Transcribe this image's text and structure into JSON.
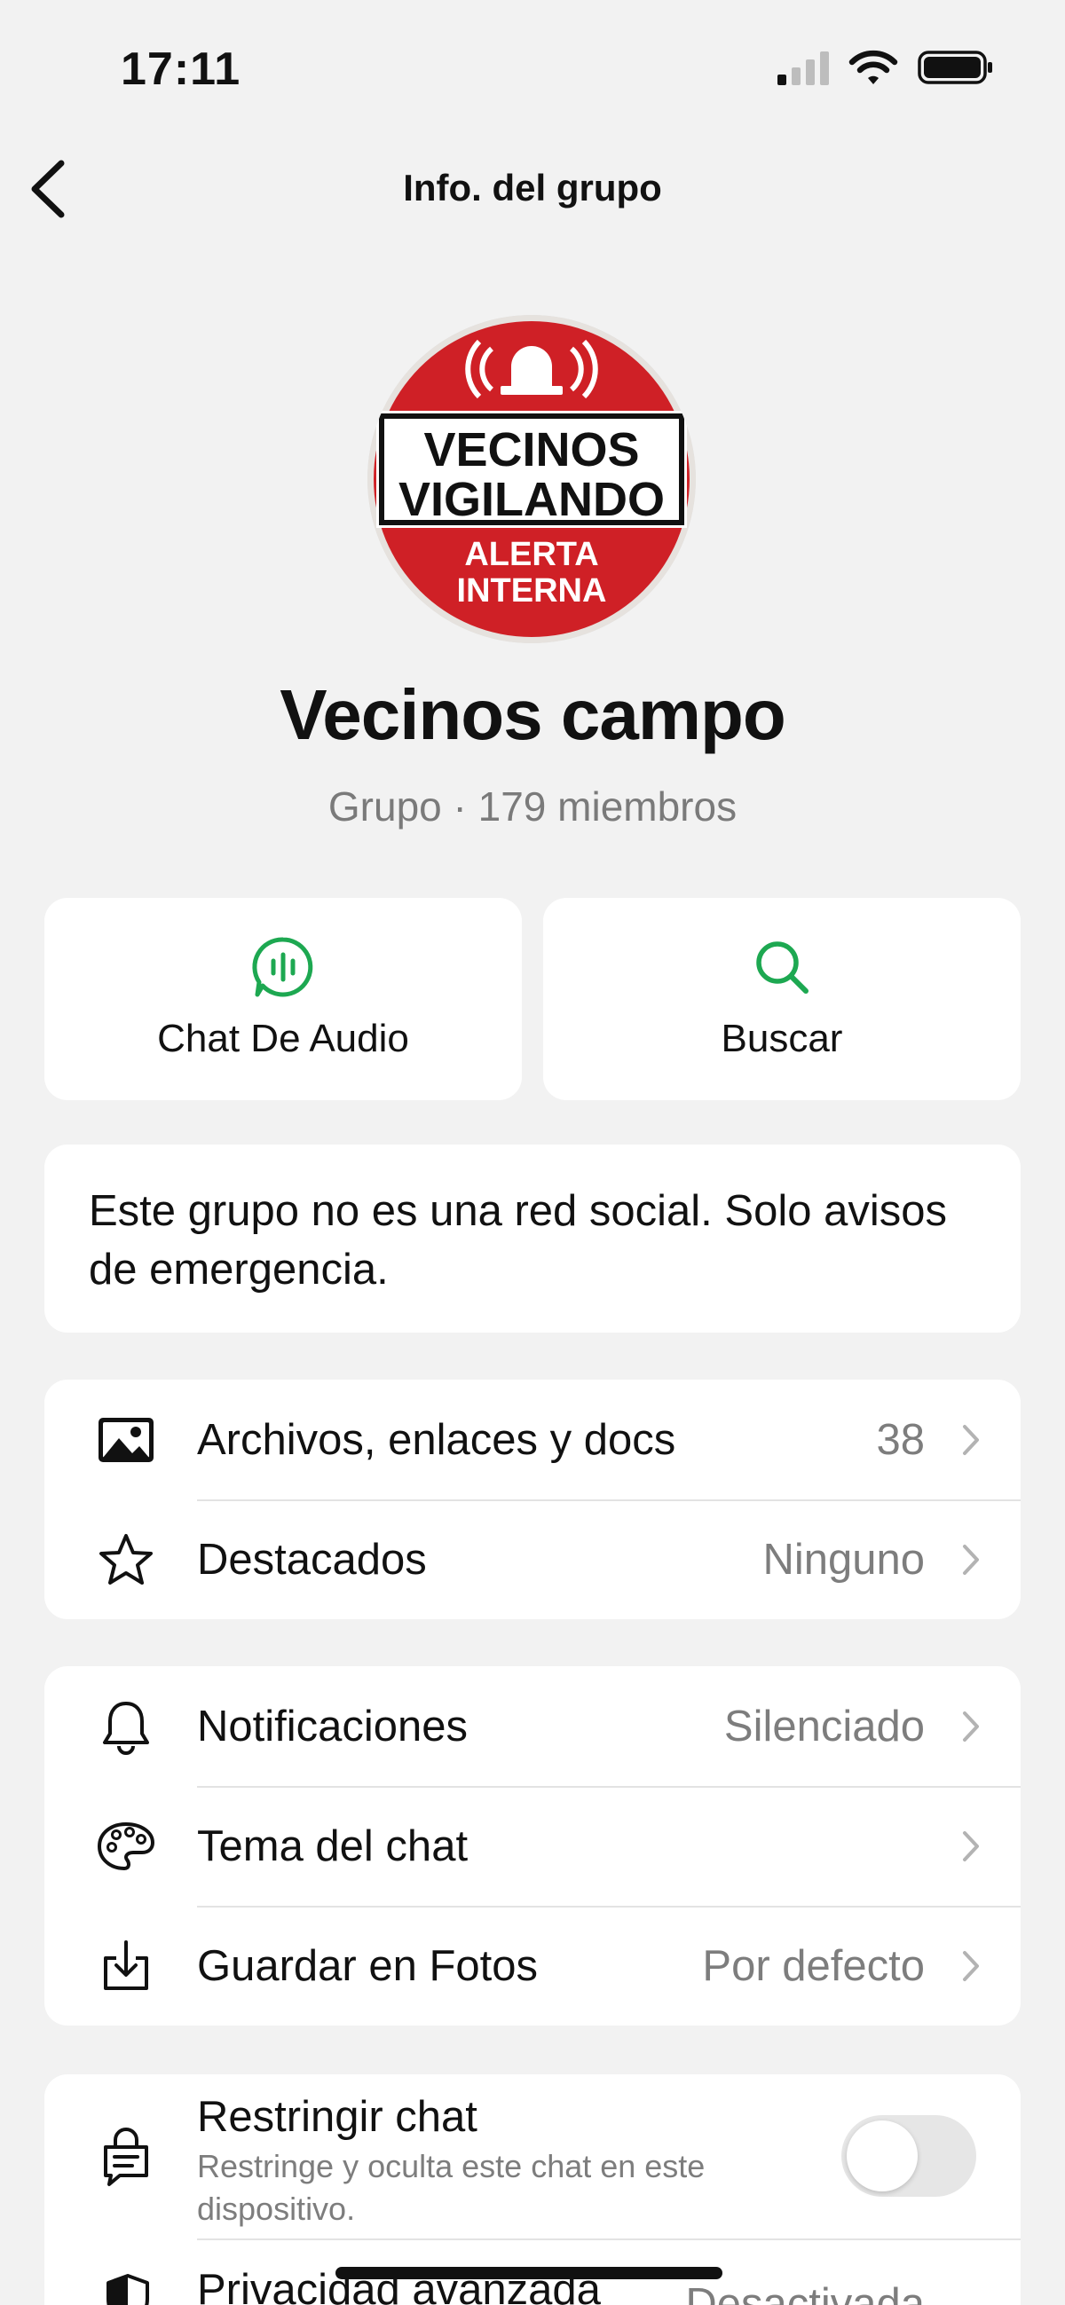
{
  "status_bar": {
    "time": "17:11"
  },
  "nav": {
    "title": "Info. del grupo"
  },
  "group": {
    "avatar": {
      "line1": "VECINOS",
      "line2": "VIGILANDO",
      "line3": "ALERTA",
      "line4": "INTERNA"
    },
    "name": "Vecinos campo",
    "subtitle": "Grupo · 179 miembros"
  },
  "actions": [
    {
      "label": "Chat De Audio",
      "icon": "audio-chat-icon"
    },
    {
      "label": "Buscar",
      "icon": "search-icon"
    }
  ],
  "description": "Este grupo no es una red social. Solo avisos de emergencia.",
  "media_section": [
    {
      "label": "Archivos, enlaces y docs",
      "value": "38",
      "icon": "image-icon"
    },
    {
      "label": "Destacados",
      "value": "Ninguno",
      "icon": "star-icon"
    }
  ],
  "settings_section": [
    {
      "label": "Notificaciones",
      "value": "Silenciado",
      "icon": "bell-icon"
    },
    {
      "label": "Tema del chat",
      "value": "",
      "icon": "palette-icon"
    },
    {
      "label": "Guardar en Fotos",
      "value": "Por defecto",
      "icon": "save-download-icon"
    }
  ],
  "privacy_section": {
    "restrict": {
      "label": "Restringir chat",
      "description": "Restringe y oculta este chat en este dispositivo.",
      "enabled": false
    },
    "advanced": {
      "label": "Privacidad avanzada",
      "value": "Desactivada"
    }
  },
  "colors": {
    "accent": "#1DA851",
    "background": "#f2f2f2",
    "secondary_text": "#7d7d7d"
  }
}
